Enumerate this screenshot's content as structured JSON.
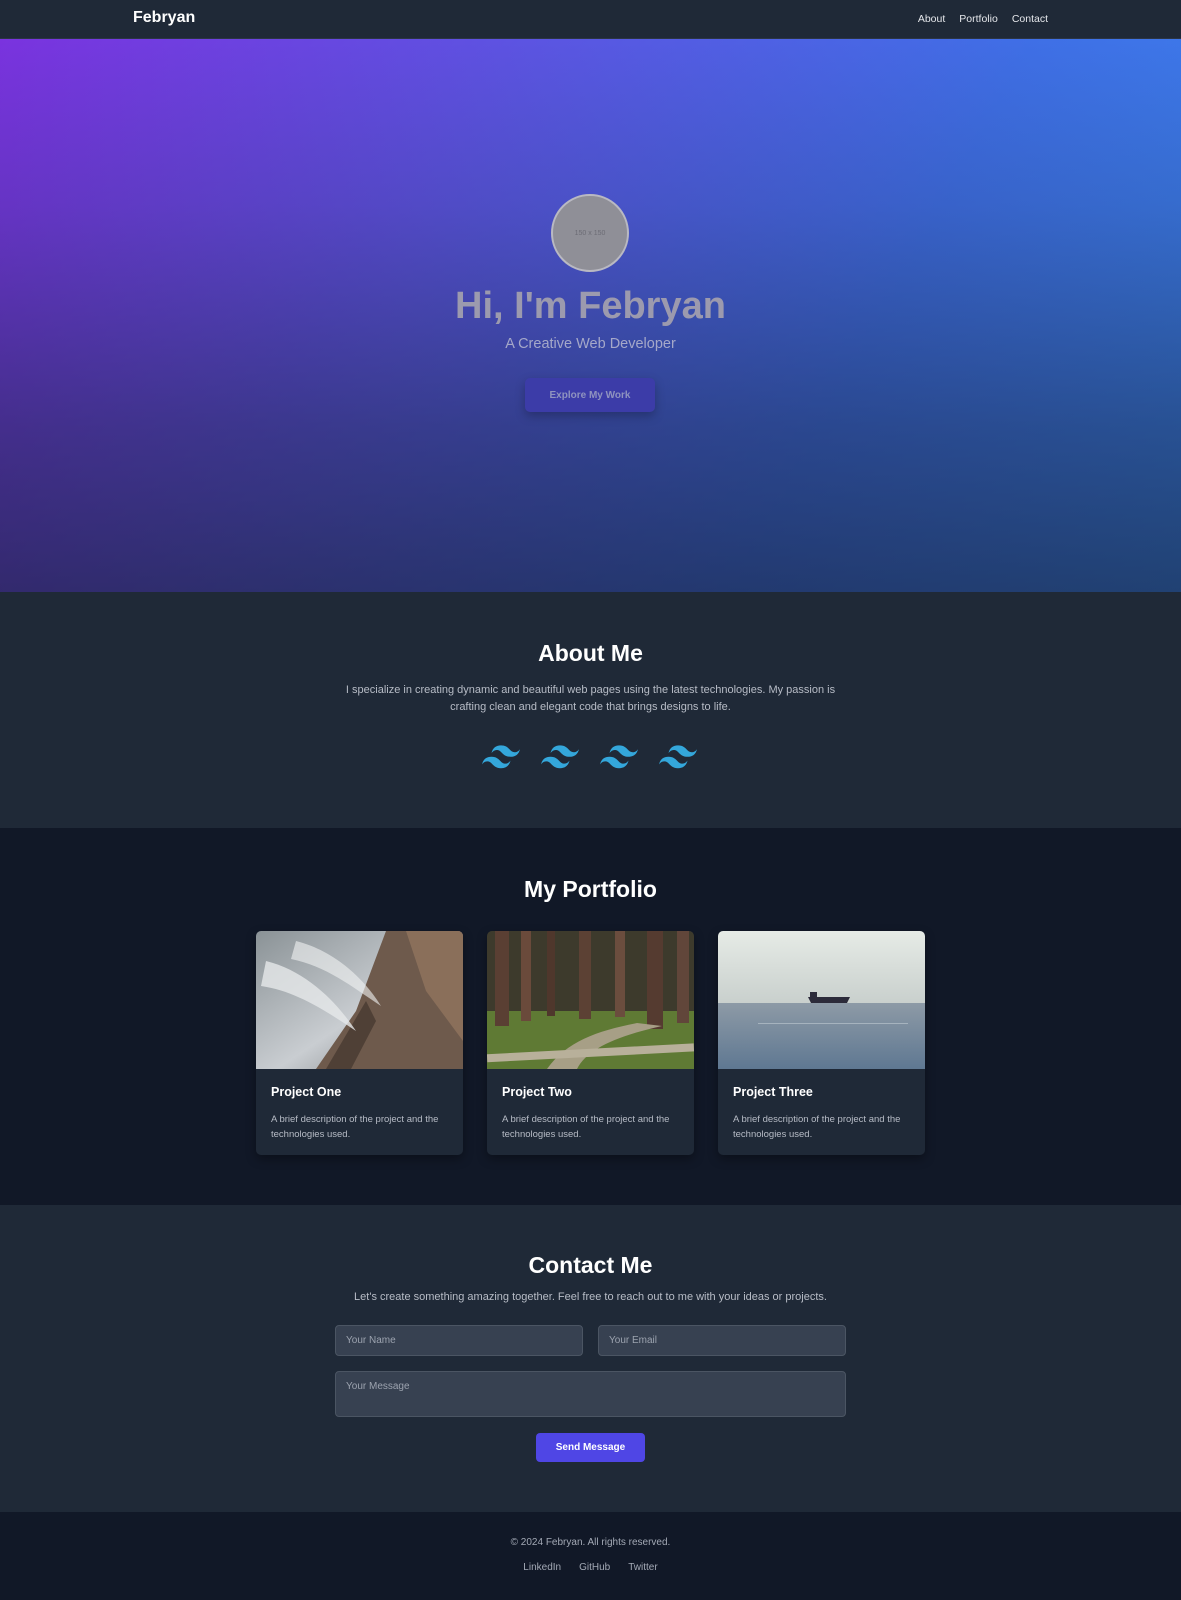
{
  "nav": {
    "brand": "Febryan",
    "links": [
      "About",
      "Portfolio",
      "Contact"
    ]
  },
  "hero": {
    "avatar_placeholder": "150 x 150",
    "title": "Hi, I'm Febryan",
    "subtitle": "A Creative Web Developer",
    "cta_label": "Explore My Work",
    "gradient_colors": [
      "#7a33df",
      "#5a56e2",
      "#3f6fe6",
      "#3a84ee"
    ]
  },
  "about": {
    "heading": "About Me",
    "text": "I specialize in creating dynamic and beautiful web pages using the latest technologies. My passion is crafting clean and elegant code that brings designs to life.",
    "skill_icons": [
      "tailwind-icon",
      "tailwind-icon",
      "tailwind-icon",
      "tailwind-icon"
    ],
    "icon_color": "#38bdf8"
  },
  "portfolio": {
    "heading": "My Portfolio",
    "projects": [
      {
        "title": "Project One",
        "description": "A brief description of the project and the technologies used.",
        "image": "waves-rocks-photo"
      },
      {
        "title": "Project Two",
        "description": "A brief description of the project and the technologies used.",
        "image": "forest-path-photo"
      },
      {
        "title": "Project Three",
        "description": "A brief description of the project and the technologies used.",
        "image": "ship-sea-photo"
      }
    ]
  },
  "contact": {
    "heading": "Contact Me",
    "lead": "Let's create something amazing together. Feel free to reach out to me with your ideas or projects.",
    "name_placeholder": "Your Name",
    "email_placeholder": "Your Email",
    "message_placeholder": "Your Message",
    "submit_label": "Send Message",
    "accent_color": "#4f46e5"
  },
  "footer": {
    "copyright": "© 2024 Febryan. All rights reserved.",
    "links": [
      "LinkedIn",
      "GitHub",
      "Twitter"
    ]
  }
}
